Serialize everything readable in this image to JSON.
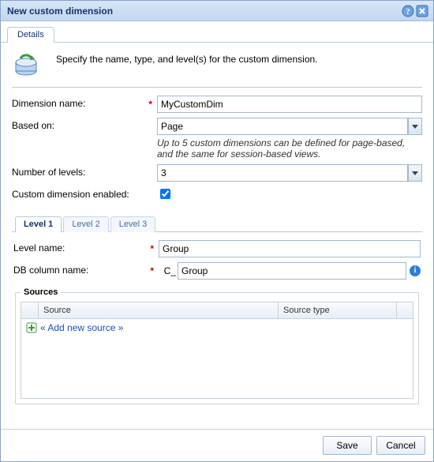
{
  "title": "New custom dimension",
  "mainTab": "Details",
  "intro": "Specify the name, type, and level(s) for the custom dimension.",
  "labels": {
    "dimName": "Dimension name:",
    "basedOn": "Based on:",
    "hint": "Up to 5 custom dimensions can be defined for page-based, and the same for session-based views.",
    "numLevels": "Number of levels:",
    "enabled": "Custom dimension enabled:",
    "levelName": "Level name:",
    "dbCol": "DB column name:",
    "dbPrefix": "C_",
    "sourcesLegend": "Sources",
    "sourceCol": "Source",
    "typeCol": "Source type",
    "addSource": "« Add new source »"
  },
  "values": {
    "dimName": "MyCustomDim",
    "basedOn": "Page",
    "numLevels": "3",
    "enabled": true,
    "levelName": "Group",
    "dbCol": "Group"
  },
  "levelTabs": [
    "Level 1",
    "Level 2",
    "Level 3"
  ],
  "footer": {
    "save": "Save",
    "cancel": "Cancel"
  }
}
